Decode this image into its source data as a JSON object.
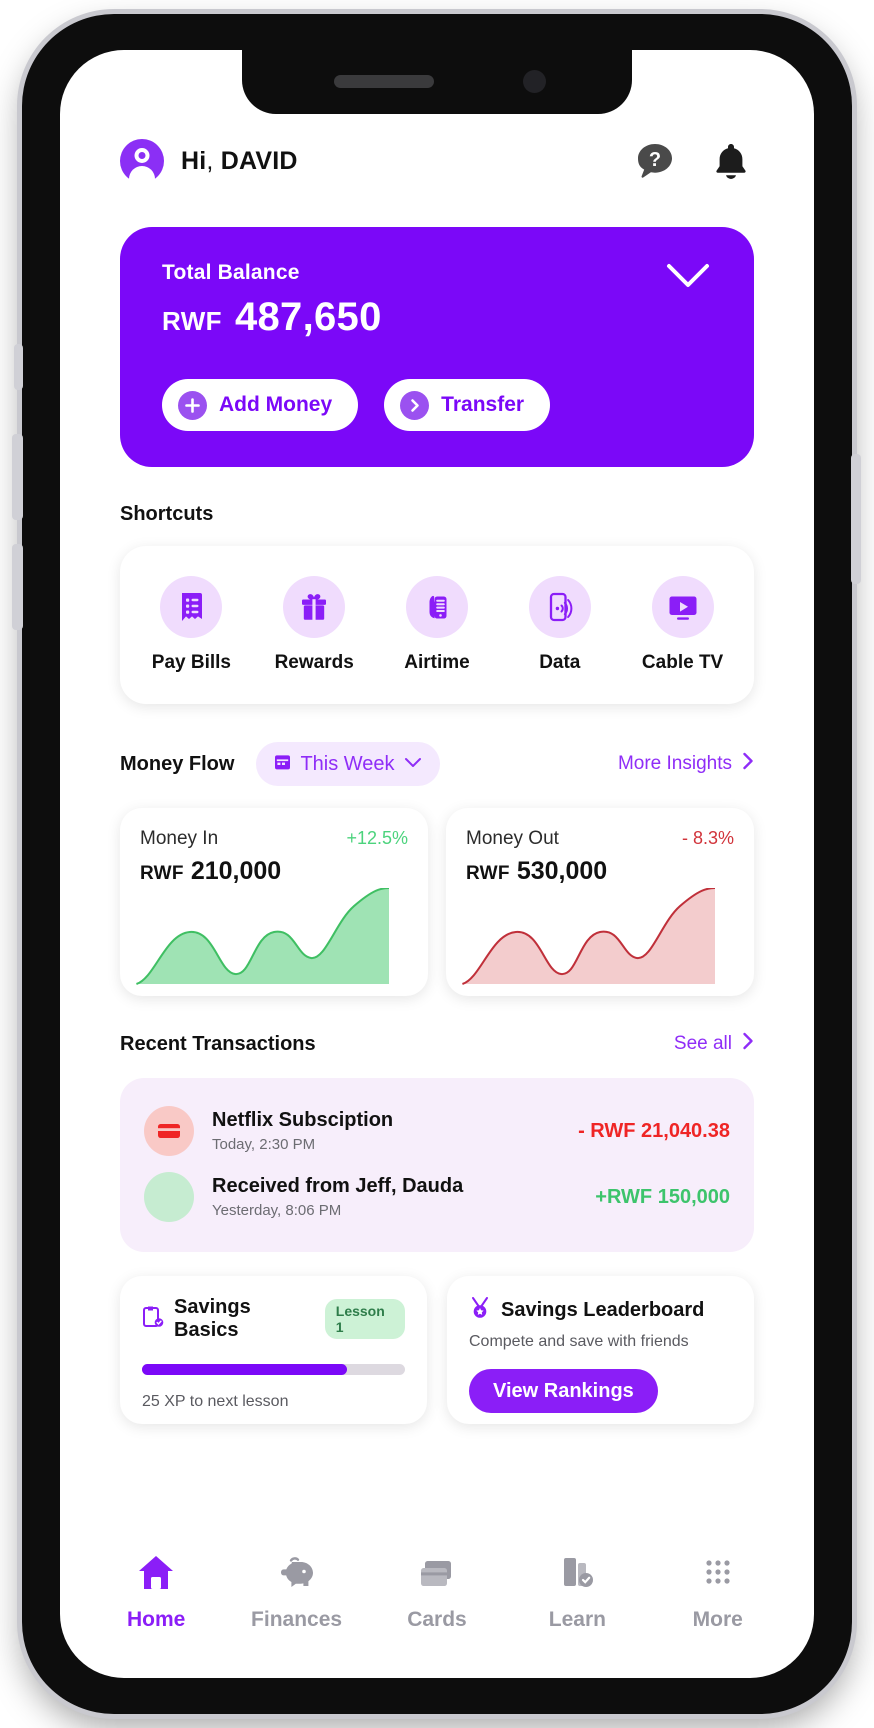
{
  "header": {
    "greeting_prefix": "Hi",
    "greeting_comma": ",",
    "user_name": "DAVID",
    "help_icon": "help-question-bubble-icon",
    "bell_icon": "notification-bell-icon",
    "avatar_icon": "user-avatar-icon"
  },
  "balance": {
    "label": "Total Balance",
    "currency": "RWF",
    "amount": "487,650",
    "collapse_icon": "chevron-down-icon",
    "add_money_label": "Add Money",
    "transfer_label": "Transfer",
    "card_color": "#7b08f8"
  },
  "shortcuts": {
    "title": "Shortcuts",
    "items": [
      {
        "label": "Pay Bills",
        "icon": "receipt-bill-icon"
      },
      {
        "label": "Rewards",
        "icon": "gift-box-icon"
      },
      {
        "label": "Airtime",
        "icon": "hand-holding-phone-icon"
      },
      {
        "label": "Data",
        "icon": "phone-signal-waves-icon"
      },
      {
        "label": "Cable TV",
        "icon": "tv-play-icon"
      }
    ]
  },
  "money_flow": {
    "title": "Money Flow",
    "period_label": "This Week",
    "period_icon": "calendar-icon",
    "period_chevron": "chevron-down-icon",
    "more_insights_label": "More Insights",
    "more_insights_icon": "chevron-right-icon",
    "cards": [
      {
        "name": "Money In",
        "delta": "+12.5%",
        "delta_color": "#4cd37d",
        "currency": "RWF",
        "value": "210,000",
        "chart_color": "#3fbf63",
        "fill_color": "#9fe3b4"
      },
      {
        "name": "Money Out",
        "delta": "- 8.3%",
        "delta_color": "#d1333a",
        "currency": "RWF",
        "value": "530,000",
        "chart_color": "#c0303a",
        "fill_color": "#f3cccd"
      }
    ]
  },
  "chart_data": [
    {
      "type": "area",
      "title": "Money In",
      "xlabel": "",
      "ylabel": "",
      "x": [
        0,
        1,
        2,
        3,
        4,
        5,
        6,
        7
      ],
      "values": [
        0,
        38,
        52,
        20,
        28,
        62,
        42,
        100
      ],
      "ylim": [
        0,
        100
      ],
      "grid": false,
      "legend": "none",
      "line_color": "#3fbf63",
      "fill_color": "#9fe3b4",
      "total": 210000,
      "currency": "RWF",
      "delta_pct": 12.5
    },
    {
      "type": "area",
      "title": "Money Out",
      "xlabel": "",
      "ylabel": "",
      "x": [
        0,
        1,
        2,
        3,
        4,
        5,
        6,
        7
      ],
      "values": [
        0,
        38,
        52,
        20,
        28,
        62,
        42,
        100
      ],
      "ylim": [
        0,
        100
      ],
      "grid": false,
      "legend": "none",
      "line_color": "#c0303a",
      "fill_color": "#f3cccd",
      "total": 530000,
      "currency": "RWF",
      "delta_pct": -8.3
    }
  ],
  "transactions": {
    "title": "Recent Transactions",
    "see_all_label": "See all",
    "see_all_icon": "chevron-right-icon",
    "rows": [
      {
        "title": "Netflix Subsciption",
        "subtitle": "Today, 2:30 PM",
        "amount": "- RWF 21,040.38",
        "amount_color": "#ef2525",
        "icon": "credit-card-icon",
        "icon_bg": "#f9c9c6"
      },
      {
        "title": "Received from Jeff, Dauda",
        "subtitle": "Yesterday, 8:06 PM",
        "amount": "+RWF 150,000",
        "amount_color": "#3dc46c",
        "icon": "incoming-transfer-icon",
        "icon_bg": "#c6ecd1"
      }
    ]
  },
  "learning": {
    "title": "Savings Basics",
    "icon": "lesson-book-icon",
    "badge": "Lesson 1",
    "progress_percent": 78,
    "xp_text": "25 XP to next lesson"
  },
  "leaderboard": {
    "title": "Savings Leaderboard",
    "icon": "trophy-medal-icon",
    "subtitle": "Compete and save with friends",
    "button_label": "View Rankings"
  },
  "bottom_nav": {
    "items": [
      {
        "label": "Home",
        "icon": "home-icon",
        "active": true
      },
      {
        "label": "Finances",
        "icon": "piggy-bank-icon",
        "active": false
      },
      {
        "label": "Cards",
        "icon": "cards-stack-icon",
        "active": false
      },
      {
        "label": "Learn",
        "icon": "learn-book-check-icon",
        "active": false
      },
      {
        "label": "More",
        "icon": "grid-dots-more-icon",
        "active": false
      }
    ]
  }
}
